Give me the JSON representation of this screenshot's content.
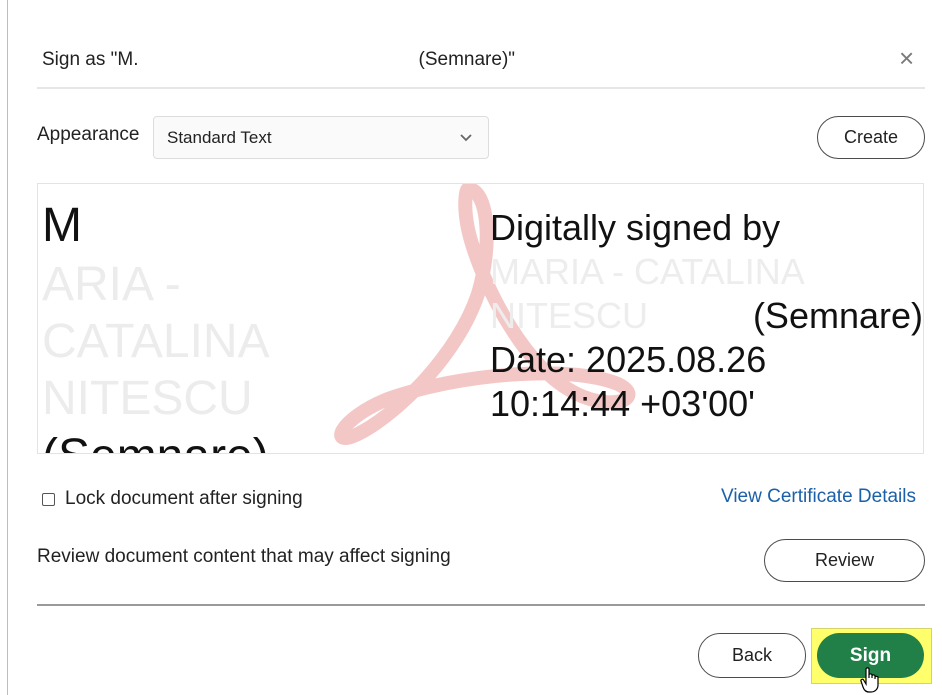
{
  "dialog": {
    "title_prefix": "Sign as \"M.",
    "title_suffix": "(Semnare)\"",
    "close_glyph": "×"
  },
  "appearance": {
    "label": "Appearance",
    "selected": "Standard Text",
    "create_label": "Create"
  },
  "preview": {
    "left_lines": [
      "M",
      "ARIA -",
      "CATALINA",
      "NITESCU",
      "(Semnare)"
    ],
    "right_lines": [
      "Digitally signed by",
      "MARIA - CATALINA",
      "NITESCU",
      "(Semnare)",
      "Date: 2025.08.26",
      "10:14:44 +03'00'"
    ]
  },
  "options": {
    "lock_label": "Lock document after signing",
    "lock_checked": false,
    "cert_link": "View Certificate Details",
    "review_text": "Review document content that may affect signing",
    "review_label": "Review"
  },
  "footer": {
    "back_label": "Back",
    "sign_label": "Sign"
  },
  "colors": {
    "sign_button": "#218048",
    "highlight": "#ffff6b",
    "link": "#1b60a8",
    "watermark": "#f4c7c7"
  },
  "icons": {
    "close": "close-icon",
    "dropdown": "chevron-down-icon",
    "watermark": "acrobat-logo-icon",
    "cursor": "hand-pointer-icon"
  }
}
